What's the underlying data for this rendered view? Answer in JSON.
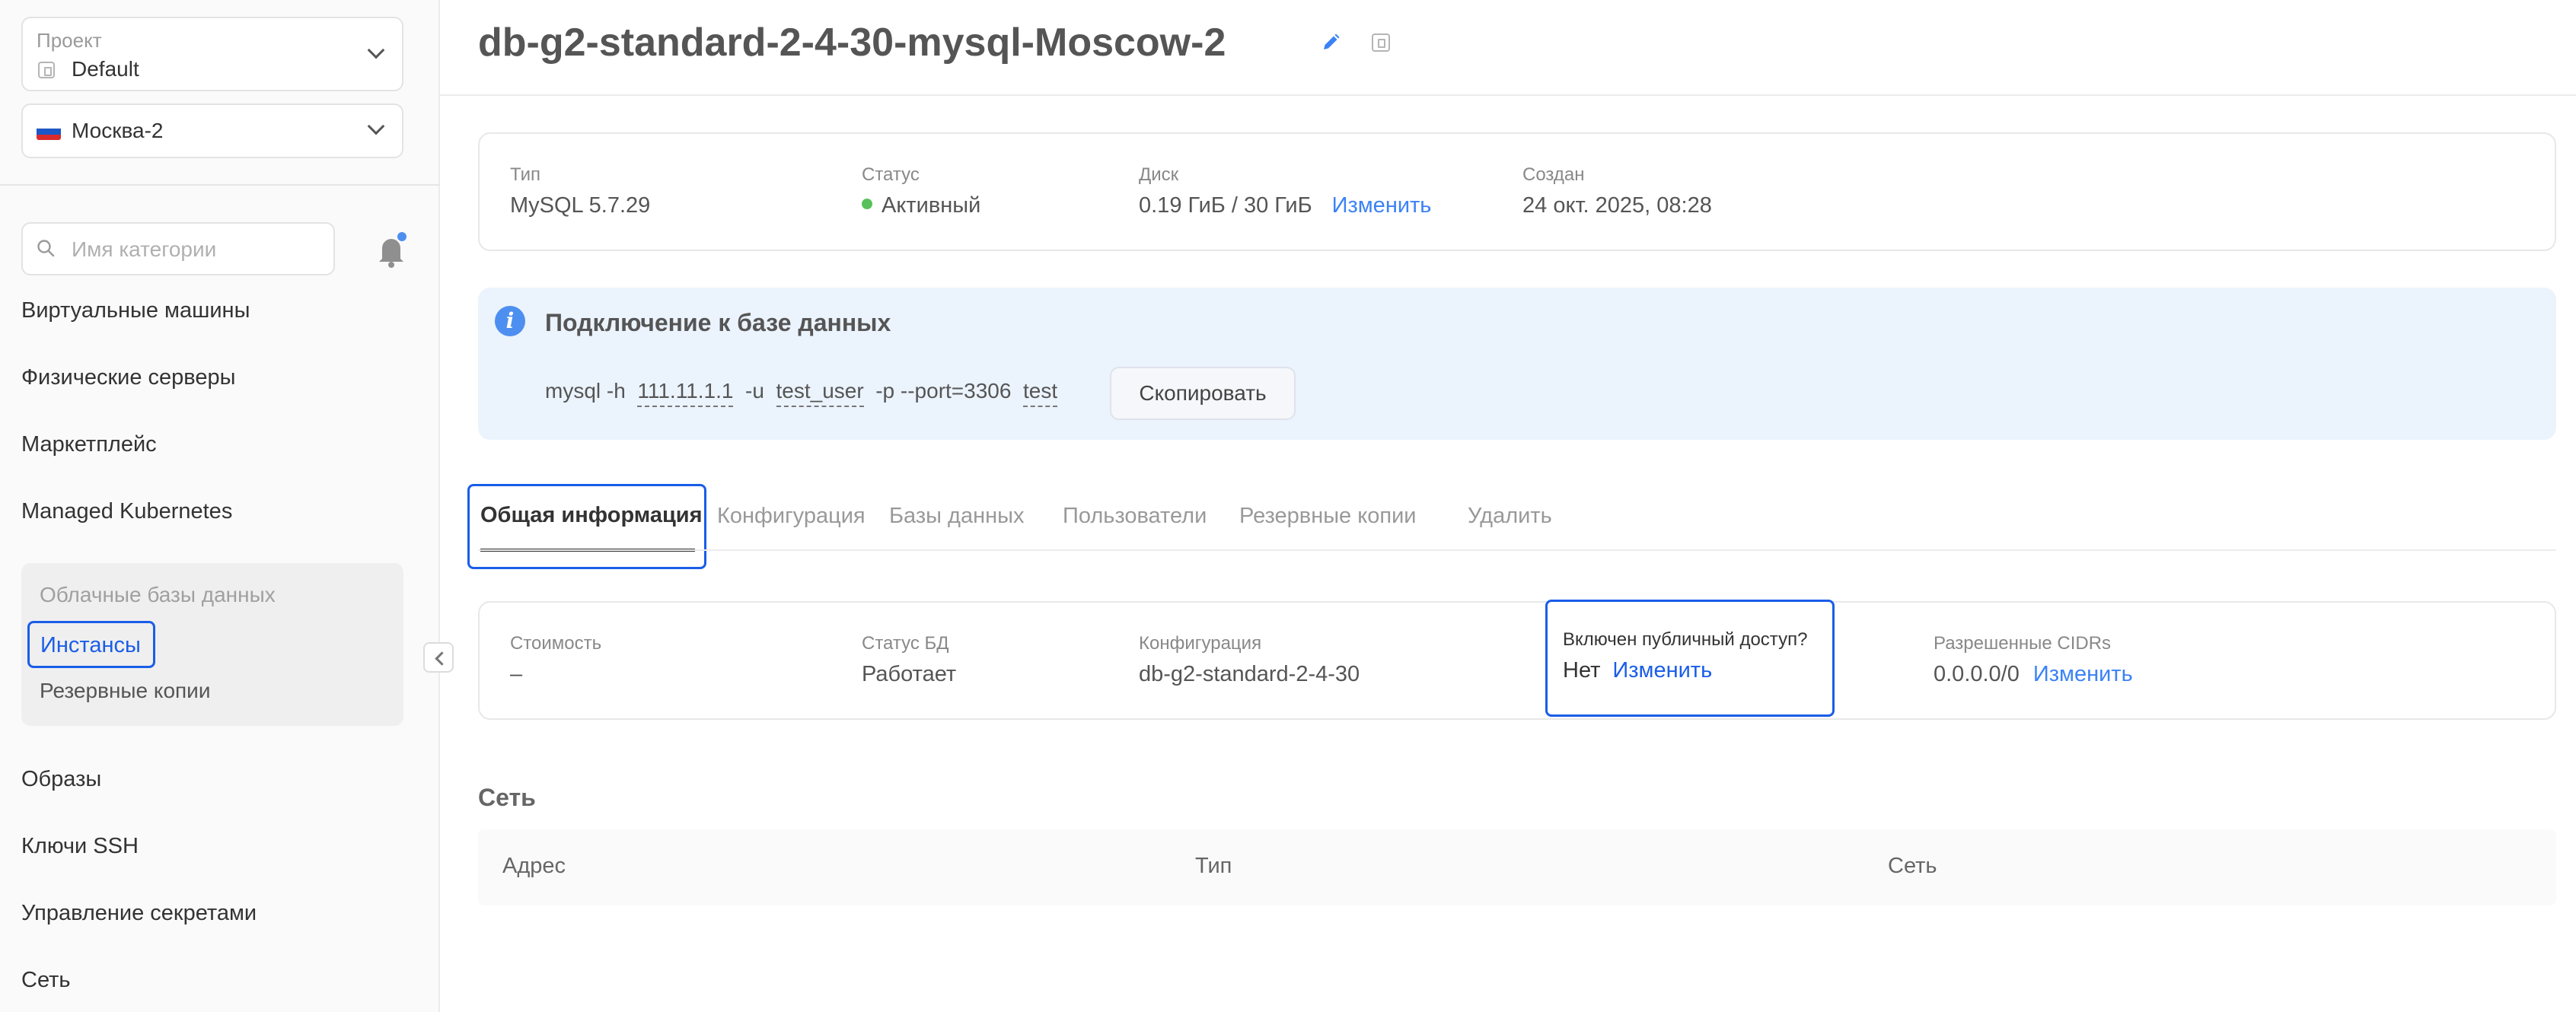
{
  "sidebar": {
    "project": {
      "caption": "Проект",
      "value": "Default"
    },
    "region": {
      "value": "Москва-2",
      "flag_colors": [
        "#ffffff",
        "#1c57c7",
        "#d92b2b"
      ]
    },
    "search": {
      "placeholder": "Имя категории"
    },
    "nav": [
      {
        "label": "Виртуальные машины"
      },
      {
        "label": "Физические серверы"
      },
      {
        "label": "Маркетплейс"
      },
      {
        "label": "Managed Kubernetes"
      }
    ],
    "subnav": {
      "section": "Облачные базы данных",
      "items": [
        {
          "label": "Инстансы",
          "active": true
        },
        {
          "label": "Резервные копии"
        }
      ]
    },
    "nav_bottom": [
      {
        "label": "Образы"
      },
      {
        "label": "Ключи SSH"
      },
      {
        "label": "Управление секретами"
      },
      {
        "label": "Сеть"
      }
    ]
  },
  "header": {
    "title": "db-g2-standard-2-4-30-mysql-Moscow-2"
  },
  "info": {
    "type": {
      "label": "Тип",
      "value": "MySQL 5.7.29"
    },
    "status": {
      "label": "Статус",
      "value": "Активный",
      "color": "#59c15b"
    },
    "disk": {
      "label": "Диск",
      "value": "0.19 ГиБ / 30 ГиБ",
      "action": "Изменить"
    },
    "created": {
      "label": "Создан",
      "value": "24 окт. 2025, 08:28"
    }
  },
  "connection": {
    "title": "Подключение к базе данных",
    "cmd_prefix": "mysql -h",
    "host": "111.11.1.1",
    "user_flag": "-u",
    "user": "test_user",
    "port_part": "-p --port=3306",
    "db": "test",
    "copy_label": "Скопировать"
  },
  "tabs": [
    {
      "label": "Общая информация",
      "active": true
    },
    {
      "label": "Конфигурация"
    },
    {
      "label": "Базы данных"
    },
    {
      "label": "Пользователи"
    },
    {
      "label": "Резервные копии"
    },
    {
      "label": "Удалить"
    }
  ],
  "general": {
    "cost": {
      "label": "Стоимость",
      "value": "–"
    },
    "db_status": {
      "label": "Статус БД",
      "value": "Работает"
    },
    "config": {
      "label": "Конфигурация",
      "value": "db-g2-standard-2-4-30"
    },
    "public_access": {
      "label": "Включен публичный доступ?",
      "value": "Нет",
      "action": "Изменить"
    },
    "cidrs": {
      "label": "Разрешенные CIDRs",
      "value": "0.0.0.0/0",
      "action": "Изменить"
    }
  },
  "network": {
    "title": "Сеть",
    "columns": [
      "Адрес",
      "Тип",
      "Сеть"
    ]
  },
  "colors": {
    "accent": "#1a5de8",
    "link": "#3b82f6",
    "info_bg": "#ebf3fd"
  }
}
